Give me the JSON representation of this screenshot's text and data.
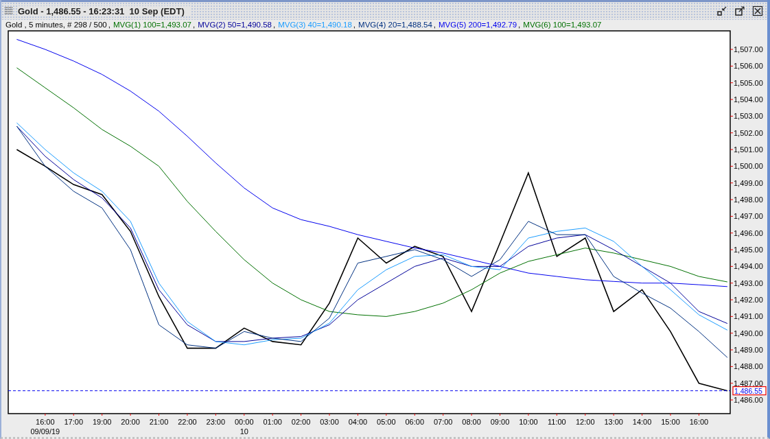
{
  "window": {
    "title": "Gold - 1,486.55 - 16:23:31  10 Sep (EDT)"
  },
  "legend": {
    "separator": ",",
    "items": [
      {
        "text": "Gold , 5 minutes, # 298 / 500",
        "color": "#000000"
      },
      {
        "text": "MVG(1) 100=1,493.07",
        "color": "#007000"
      },
      {
        "text": "MVG(2) 50=1,490.58",
        "color": "#000099"
      },
      {
        "text": "MVG(3) 40=1,490.18",
        "color": "#1a9cff"
      },
      {
        "text": "MVG(4) 20=1,488.54",
        "color": "#003080"
      },
      {
        "text": "MVG(5) 200=1,492.79",
        "color": "#0000ee"
      },
      {
        "text": "MVG(6) 100=1,493.07",
        "color": "#007000"
      }
    ]
  },
  "chart": {
    "current_price": {
      "label": "1,486.55"
    },
    "date_row": [
      "09/09/19",
      "10"
    ],
    "chart_data": {
      "type": "line",
      "categories": [
        null,
        "16:00",
        "17:00",
        "19:00",
        "20:00",
        "21:00",
        "22:00",
        "23:00",
        "00:00",
        "01:00",
        "02:00",
        "03:00",
        "04:00",
        "05:00",
        "06:00",
        "07:00",
        "08:00",
        "09:00",
        "10:00",
        "11:00",
        "12:00",
        "13:00",
        "14:00",
        "15:00",
        "16:00",
        null
      ],
      "series": [
        {
          "color": "#000000",
          "values": [
            1501.0,
            1500.0,
            1498.9,
            1498.3,
            1496.1,
            1492.2,
            1489.1,
            1489.1,
            1490.3,
            1489.5,
            1489.3,
            1491.8,
            1495.7,
            1494.2,
            1495.2,
            1494.6,
            1491.3,
            1495.4,
            1499.6,
            1494.6,
            1495.7,
            1491.3,
            1492.6,
            1490.1,
            1487.0,
            1486.55
          ]
        },
        {
          "color": "#0000ee",
          "values": [
            1507.6,
            1507.0,
            1506.3,
            1505.5,
            1504.5,
            1503.3,
            1501.8,
            1500.2,
            1498.7,
            1497.5,
            1496.8,
            1496.4,
            1495.9,
            1495.5,
            1495.1,
            1494.8,
            1494.4,
            1494.0,
            1493.6,
            1493.4,
            1493.2,
            1493.1,
            1493.0,
            1493.0,
            1492.9,
            1492.79
          ]
        },
        {
          "color": "#007000",
          "values": [
            1505.9,
            1504.7,
            1503.5,
            1502.2,
            1501.2,
            1500.0,
            1497.9,
            1496.1,
            1494.4,
            1493.0,
            1492.0,
            1491.3,
            1491.1,
            1491.0,
            1491.3,
            1491.8,
            1492.6,
            1493.6,
            1494.3,
            1494.7,
            1495.1,
            1494.8,
            1494.4,
            1494.0,
            1493.4,
            1493.07
          ]
        },
        {
          "color": "#000099",
          "values": [
            1502.4,
            1500.6,
            1499.2,
            1498.1,
            1496.3,
            1492.6,
            1490.5,
            1489.5,
            1489.5,
            1489.7,
            1489.8,
            1490.5,
            1492.0,
            1493.0,
            1494.0,
            1494.5,
            1494.0,
            1494.0,
            1495.2,
            1495.7,
            1495.9,
            1495.0,
            1494.0,
            1493.0,
            1491.3,
            1490.58
          ]
        },
        {
          "color": "#1a9cff",
          "values": [
            1502.6,
            1501.0,
            1499.6,
            1498.5,
            1496.7,
            1493.0,
            1490.7,
            1489.5,
            1489.3,
            1489.6,
            1489.7,
            1490.6,
            1492.6,
            1493.8,
            1494.6,
            1494.7,
            1494.0,
            1493.8,
            1495.7,
            1496.1,
            1496.3,
            1495.5,
            1494.0,
            1492.6,
            1491.1,
            1490.18
          ]
        },
        {
          "color": "#003080",
          "values": [
            1502.4,
            1500.0,
            1498.5,
            1497.5,
            1495.0,
            1490.5,
            1489.3,
            1489.1,
            1490.1,
            1489.7,
            1489.5,
            1490.9,
            1494.2,
            1494.6,
            1495.0,
            1494.4,
            1493.4,
            1494.4,
            1496.7,
            1495.9,
            1495.9,
            1493.4,
            1492.4,
            1491.5,
            1490.1,
            1488.54
          ]
        }
      ],
      "ylim": [
        1485.18,
        1508.11
      ],
      "ref_lines": [
        {
          "axis": "y",
          "value": 1486.55
        }
      ],
      "yticks": [
        {
          "value": 1507,
          "label": "1,507.00"
        },
        {
          "value": 1506,
          "label": "1,506.00"
        },
        {
          "value": 1505,
          "label": "1,505.00"
        },
        {
          "value": 1504,
          "label": "1,504.00"
        },
        {
          "value": 1503,
          "label": "1,503.00"
        },
        {
          "value": 1502,
          "label": "1,502.00"
        },
        {
          "value": 1501,
          "label": "1,501.00"
        },
        {
          "value": 1500,
          "label": "1,500.00"
        },
        {
          "value": 1499,
          "label": "1,499.00"
        },
        {
          "value": 1498,
          "label": "1,498.00"
        },
        {
          "value": 1497,
          "label": "1,497.00"
        },
        {
          "value": 1496,
          "label": "1,496.00"
        },
        {
          "value": 1495,
          "label": "1,495.00"
        },
        {
          "value": 1494,
          "label": "1,494.00"
        },
        {
          "value": 1493,
          "label": "1,493.00"
        },
        {
          "value": 1492,
          "label": "1,492.00"
        },
        {
          "value": 1491,
          "label": "1,491.00"
        },
        {
          "value": 1490,
          "label": "1,490.00"
        },
        {
          "value": 1489,
          "label": "1,489.00"
        },
        {
          "value": 1488,
          "label": "1,488.00"
        },
        {
          "value": 1487,
          "label": "1,487.00"
        },
        {
          "value": 1486,
          "label": "1,486.00"
        }
      ]
    }
  }
}
